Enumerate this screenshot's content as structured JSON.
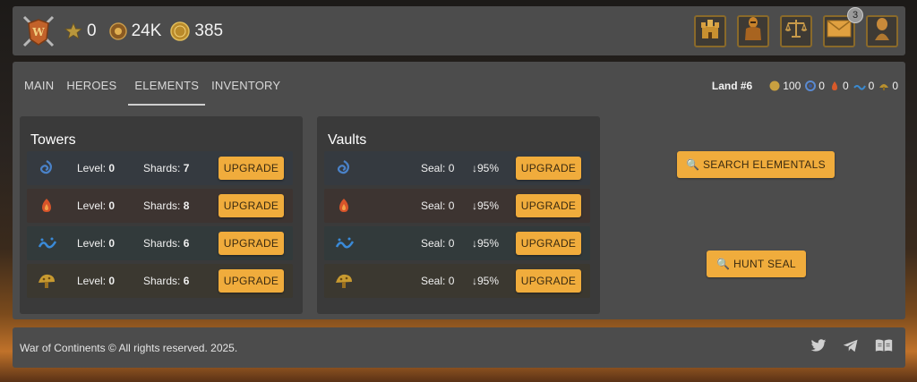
{
  "header": {
    "stats": [
      {
        "icon": "vip-star-icon",
        "value": "0"
      },
      {
        "icon": "power-gear-icon",
        "value": "24K"
      },
      {
        "icon": "gold-coin-icon",
        "value": "385"
      }
    ],
    "nav": [
      {
        "icon": "castle-icon"
      },
      {
        "icon": "knight-armor-icon"
      },
      {
        "icon": "balance-scale-icon"
      },
      {
        "icon": "mail-icon",
        "badge": "3"
      },
      {
        "icon": "profile-bust-icon"
      }
    ]
  },
  "tabs": [
    {
      "label": "MAIN"
    },
    {
      "label": "HEROES"
    },
    {
      "label": "ELEMENTS"
    },
    {
      "label": "INVENTORY"
    }
  ],
  "active_tab": "ELEMENTS",
  "land": {
    "name": "Land #6",
    "resources": [
      {
        "icon": "gold-coin-icon",
        "value": "100"
      },
      {
        "icon": "water-element-icon",
        "value": "0"
      },
      {
        "icon": "fire-element-icon",
        "value": "0"
      },
      {
        "icon": "air-element-icon",
        "value": "0"
      },
      {
        "icon": "earth-element-icon",
        "value": "0"
      }
    ]
  },
  "towers": {
    "title": "Towers",
    "level_label": "Level:",
    "shards_label": "Shards:",
    "button_label": "UPGRADE",
    "rows": [
      {
        "element": "water",
        "level": "0",
        "shards": "7"
      },
      {
        "element": "fire",
        "level": "0",
        "shards": "8"
      },
      {
        "element": "air",
        "level": "0",
        "shards": "6"
      },
      {
        "element": "earth",
        "level": "0",
        "shards": "6"
      }
    ]
  },
  "vaults": {
    "title": "Vaults",
    "seal_label": "Seal:",
    "button_label": "UPGRADE",
    "rows": [
      {
        "element": "water",
        "seal": "0",
        "rate": "↓95%"
      },
      {
        "element": "fire",
        "seal": "0",
        "rate": "↓95%"
      },
      {
        "element": "air",
        "seal": "0",
        "rate": "↓95%"
      },
      {
        "element": "earth",
        "seal": "0",
        "rate": "↓95%"
      }
    ]
  },
  "actions": {
    "search": "🔍 SEARCH ELEMENTALS",
    "hunt": "🔍 HUNT SEAL"
  },
  "footer": {
    "copyright": "War of Continents © All rights reserved. 2025.",
    "socials": [
      "twitter-icon",
      "telegram-icon",
      "docs-book-icon"
    ]
  },
  "colors": {
    "accent": "#f0ac3c",
    "panel": "#4c4c4c",
    "water_row": "#353a40",
    "fire_row": "#3d3431",
    "air_row": "#323a3b",
    "earth_row": "#3b3830"
  }
}
